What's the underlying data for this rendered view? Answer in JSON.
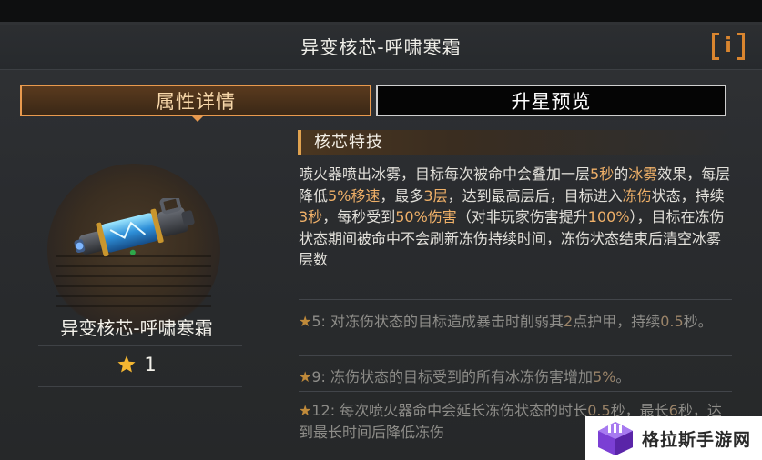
{
  "header": {
    "title": "异变核芯-呼啸寒霜",
    "info_icon": "info-icon"
  },
  "tabs": [
    {
      "label": "属性详情",
      "active": true
    },
    {
      "label": "升星预览",
      "active": false
    }
  ],
  "item": {
    "name": "异变核芯-呼啸寒霜",
    "star_level": "1",
    "icon": "frost-flamethrower-core"
  },
  "core_skill": {
    "heading": "核芯特技",
    "description": [
      {
        "t": "喷火器喷出冰雾，目标每次被命中会叠加一层"
      },
      {
        "t": "5秒",
        "hl": true
      },
      {
        "t": "的"
      },
      {
        "t": "冰雾",
        "hl": true
      },
      {
        "t": "效果，每层降低"
      },
      {
        "t": "5%移速",
        "hl": true
      },
      {
        "t": "，最多"
      },
      {
        "t": "3层",
        "hl": true
      },
      {
        "t": "，达到最高层后，目标进入"
      },
      {
        "t": "冻伤",
        "hl": true
      },
      {
        "t": "状态，持续"
      },
      {
        "t": "3秒",
        "hl": true
      },
      {
        "t": "，每秒受到"
      },
      {
        "t": "50%伤害",
        "hl": true
      },
      {
        "t": "（对非玩家伤害提升"
      },
      {
        "t": "100%",
        "hl": true
      },
      {
        "t": "），目标在冻伤状态期间被命中不会刷新冻伤持续时间，冻伤状态结束后清空冰雾层数"
      }
    ]
  },
  "perks": [
    {
      "star": "★",
      "level": "5",
      "text_a": ": 对冻伤状态的目标造成暴击时削弱其",
      "num": "2",
      "text_b": "点护甲，持续",
      "num2": "0.5",
      "text_c": "秒。"
    },
    {
      "star": "★",
      "level": "9",
      "text_a": ": 冻伤状态的目标受到的所有冰冻伤害增加",
      "num": "5%",
      "text_b": "。",
      "num2": "",
      "text_c": ""
    },
    {
      "star": "★",
      "level": "12",
      "text_a": ": 每次喷火器命中会延长冻伤状态的时长",
      "num": "0.5",
      "text_b": "秒，最长",
      "num2": "6",
      "text_c": "秒，达到最长时间后降低冻伤"
    }
  ],
  "watermark": {
    "text": "格拉斯手游网"
  },
  "colors": {
    "accent": "#e99a4e",
    "highlight": "#efb068",
    "star": "#f5b731"
  }
}
